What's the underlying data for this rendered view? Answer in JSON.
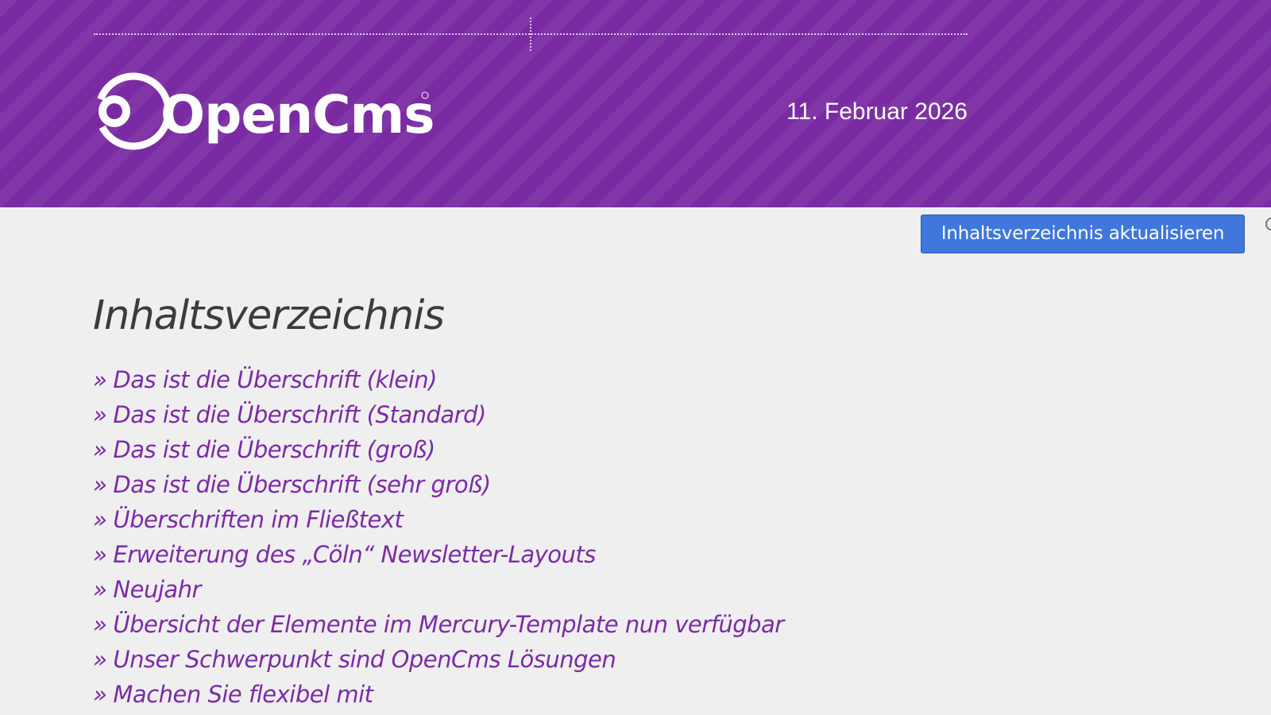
{
  "header": {
    "logo_text": "OpenCms",
    "date": "11. Februar 2026"
  },
  "toolbar": {
    "update_button_label": "Inhaltsverzeichnis aktualisieren"
  },
  "toc": {
    "title": "Inhaltsverzeichnis",
    "marker": "»",
    "items": [
      "Das ist die Überschrift (klein)",
      "Das ist die Überschrift (Standard)",
      "Das ist die Überschrift (groß)",
      "Das ist die Überschrift (sehr groß)",
      "Überschriften im Fließtext",
      "Erweiterung des „Cöln“ Newsletter-Layouts",
      "Neujahr",
      "Übersicht der Elemente im Mercury-Template nun verfügbar",
      "Unser Schwerpunkt sind OpenCms Lösungen",
      "Machen Sie flexibel mit"
    ]
  },
  "colors": {
    "header_bg": "#7a2ba3",
    "link": "#7b2ba6",
    "button": "#3f77dd",
    "page_bg": "#efefef"
  }
}
